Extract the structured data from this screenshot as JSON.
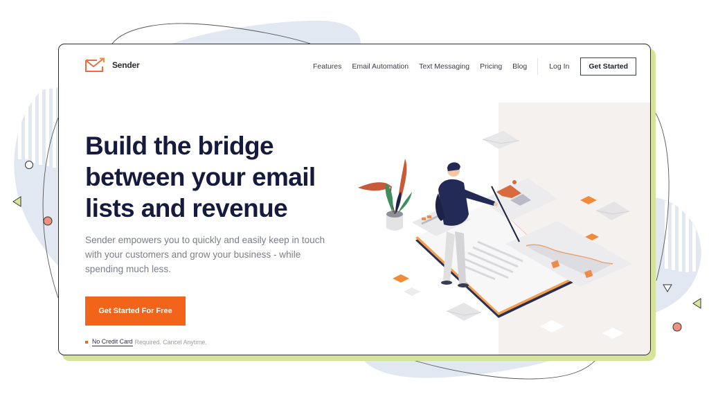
{
  "brand": {
    "name": "Sender",
    "accent_color": "#f26419",
    "heading_color": "#161a3d",
    "frame_shadow_color": "#d6e39a"
  },
  "nav": {
    "links": [
      {
        "label": "Features"
      },
      {
        "label": "Email Automation"
      },
      {
        "label": "Text Messaging"
      },
      {
        "label": "Pricing"
      },
      {
        "label": "Blog"
      }
    ],
    "login_label": "Log In",
    "cta_label": "Get Started"
  },
  "hero": {
    "title_lines": [
      "Build the bridge",
      "between your email",
      "lists and revenue"
    ],
    "subtitle": "Sender empowers you to quickly and easily keep in touch with your customers and grow your business - while spending much less.",
    "cta_label": "Get Started For Free",
    "note_strong": "No Credit Card",
    "note_rest": "Required. Cancel Anytime."
  },
  "illustration": {
    "description": "isometric-person-with-pointer-over-email-dashboards",
    "icons": [
      "plant-icon",
      "person-icon",
      "envelope-icon",
      "chart-card-icon"
    ]
  }
}
